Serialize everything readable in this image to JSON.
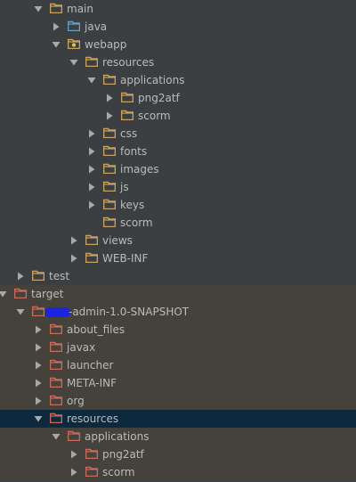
{
  "colors": {
    "background": "#3c3f41",
    "excluded_background": "#45423b",
    "selected_background": "#0d293e",
    "text": "#bbbbbb",
    "folder_source": "#c9a15f",
    "folder_excluded": "#c86b5a",
    "folder_java_source": "#6a9fc4",
    "arrow": "#a9a9a9"
  },
  "tree": {
    "rows": [
      {
        "label": "main",
        "depth": 0,
        "state": "expanded",
        "icon": "folder-icon",
        "style": "normal"
      },
      {
        "label": "java",
        "depth": 1,
        "state": "collapsed",
        "icon": "source-folder-icon",
        "style": "normal"
      },
      {
        "label": "webapp",
        "depth": 1,
        "state": "expanded",
        "icon": "web-folder-icon",
        "style": "normal"
      },
      {
        "label": "resources",
        "depth": 2,
        "state": "expanded",
        "icon": "folder-icon",
        "style": "normal"
      },
      {
        "label": "applications",
        "depth": 3,
        "state": "expanded",
        "icon": "folder-icon",
        "style": "normal"
      },
      {
        "label": "png2atf",
        "depth": 4,
        "state": "collapsed",
        "icon": "folder-icon",
        "style": "normal"
      },
      {
        "label": "scorm",
        "depth": 4,
        "state": "collapsed",
        "icon": "folder-icon",
        "style": "normal"
      },
      {
        "label": "css",
        "depth": 3,
        "state": "collapsed",
        "icon": "folder-icon",
        "style": "normal"
      },
      {
        "label": "fonts",
        "depth": 3,
        "state": "collapsed",
        "icon": "folder-icon",
        "style": "normal"
      },
      {
        "label": "images",
        "depth": 3,
        "state": "collapsed",
        "icon": "folder-icon",
        "style": "normal"
      },
      {
        "label": "js",
        "depth": 3,
        "state": "collapsed",
        "icon": "folder-icon",
        "style": "normal"
      },
      {
        "label": "keys",
        "depth": 3,
        "state": "collapsed",
        "icon": "folder-icon",
        "style": "normal"
      },
      {
        "label": "scorm",
        "depth": 3,
        "state": "leaf",
        "icon": "folder-icon",
        "style": "normal"
      },
      {
        "label": "views",
        "depth": 2,
        "state": "collapsed",
        "icon": "folder-icon",
        "style": "normal"
      },
      {
        "label": "WEB-INF",
        "depth": 2,
        "state": "collapsed",
        "icon": "folder-icon",
        "style": "normal"
      },
      {
        "label": "test",
        "depth": -1,
        "state": "collapsed",
        "icon": "folder-icon",
        "style": "normal"
      },
      {
        "label": "target",
        "depth": -2,
        "state": "expanded",
        "icon": "excluded-folder-icon",
        "style": "excluded"
      },
      {
        "label": "-admin-1.0-SNAPSHOT",
        "depth": -1,
        "state": "expanded",
        "icon": "excluded-folder-icon",
        "style": "excluded",
        "redacted": true
      },
      {
        "label": "about_files",
        "depth": 0,
        "state": "collapsed",
        "icon": "excluded-folder-icon",
        "style": "excluded"
      },
      {
        "label": "javax",
        "depth": 0,
        "state": "collapsed",
        "icon": "excluded-folder-icon",
        "style": "excluded"
      },
      {
        "label": "launcher",
        "depth": 0,
        "state": "collapsed",
        "icon": "excluded-folder-icon",
        "style": "excluded"
      },
      {
        "label": "META-INF",
        "depth": 0,
        "state": "collapsed",
        "icon": "excluded-folder-icon",
        "style": "excluded"
      },
      {
        "label": "org",
        "depth": 0,
        "state": "collapsed",
        "icon": "excluded-folder-icon",
        "style": "excluded"
      },
      {
        "label": "resources",
        "depth": 0,
        "state": "expanded",
        "icon": "excluded-folder-icon",
        "style": "selected"
      },
      {
        "label": "applications",
        "depth": 1,
        "state": "expanded",
        "icon": "excluded-folder-icon",
        "style": "excluded"
      },
      {
        "label": "png2atf",
        "depth": 2,
        "state": "collapsed",
        "icon": "excluded-folder-icon",
        "style": "excluded"
      },
      {
        "label": "scorm",
        "depth": 2,
        "state": "collapsed",
        "icon": "excluded-folder-icon",
        "style": "excluded"
      }
    ]
  }
}
